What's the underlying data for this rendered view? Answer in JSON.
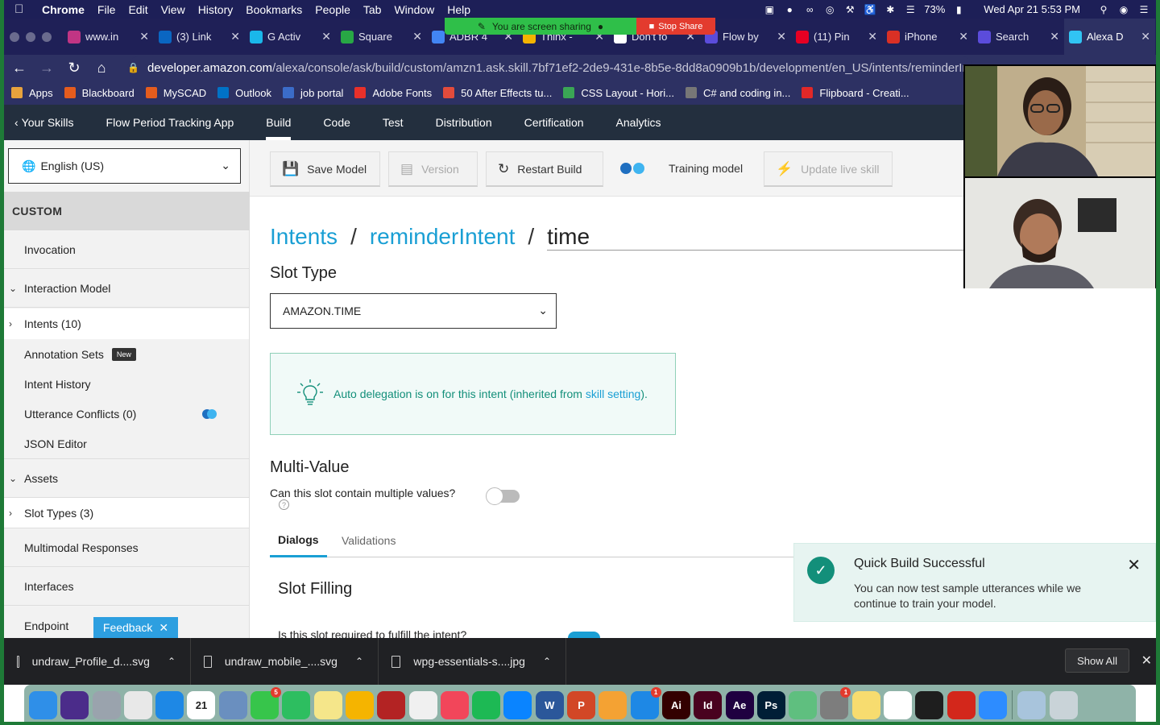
{
  "menubar": {
    "app": "Chrome",
    "menus": [
      "File",
      "Edit",
      "View",
      "History",
      "Bookmarks",
      "People",
      "Tab",
      "Window",
      "Help"
    ],
    "battery": "73%",
    "datetime": "Wed Apr 21  5:53 PM"
  },
  "screenshare": {
    "status": "You are screen sharing",
    "stop_label": "Stop Share"
  },
  "tabs": [
    {
      "title": "www.in",
      "icon": "instagram-icon",
      "color": "#c13584"
    },
    {
      "title": "(3) Link",
      "icon": "linkedin-icon",
      "color": "#0a66c2"
    },
    {
      "title": "G Activ",
      "icon": "vimeo-icon",
      "color": "#1ab7ea"
    },
    {
      "title": "Square",
      "icon": "square-icon",
      "color": "#28a745"
    },
    {
      "title": "ADBR 4",
      "icon": "docs-icon",
      "color": "#4285f4"
    },
    {
      "title": "Thinx -",
      "icon": "folder-icon",
      "color": "#f4b400"
    },
    {
      "title": "Don't fo",
      "icon": "quote-icon",
      "color": "#ffffff"
    },
    {
      "title": "Flow by",
      "icon": "canva-icon",
      "color": "#5b4cdb"
    },
    {
      "title": "(11) Pin",
      "icon": "pinterest-icon",
      "color": "#e60023"
    },
    {
      "title": "iPhone",
      "icon": "ps-icon",
      "color": "#d93025"
    },
    {
      "title": "Search",
      "icon": "search-tab-icon",
      "color": "#5b4cdb"
    },
    {
      "title": "Alexa D",
      "icon": "alexa-icon",
      "color": "#31c4f3"
    }
  ],
  "address": {
    "domain": "developer.amazon.com",
    "path": "/alexa/console/ask/build/custom/amzn1.ask.skill.7bf71ef2-2de9-431e-8b5e-8dd8a0909b1b/development/en_US/intents/reminderIn"
  },
  "bookmarks": [
    {
      "label": "Apps",
      "color": "#e8a33d"
    },
    {
      "label": "Blackboard",
      "color": "#e55c1e"
    },
    {
      "label": "MySCAD",
      "color": "#e55c1e"
    },
    {
      "label": "Outlook",
      "color": "#0072c6"
    },
    {
      "label": "job portal",
      "color": "#3b6cc9"
    },
    {
      "label": "Adobe Fonts",
      "color": "#e8302a"
    },
    {
      "label": "50 After Effects tu...",
      "color": "#e34b3c"
    },
    {
      "label": "CSS Layout - Hori...",
      "color": "#3aa655"
    },
    {
      "label": "C# and coding in...",
      "color": "#777777"
    },
    {
      "label": "Flipboard - Creati...",
      "color": "#e12828"
    }
  ],
  "alexanav": {
    "back": "Your Skills",
    "items": [
      "Flow Period Tracking App",
      "Build",
      "Code",
      "Test",
      "Distribution",
      "Certification",
      "Analytics"
    ]
  },
  "sidebar": {
    "language": "English (US)",
    "section": "CUSTOM",
    "invocation": "Invocation",
    "interaction_model": "Interaction Model",
    "intents": "Intents (10)",
    "annotation_sets": "Annotation Sets",
    "new_badge": "New",
    "intent_history": "Intent History",
    "utterance_conflicts": "Utterance Conflicts (0)",
    "json_editor": "JSON Editor",
    "assets": "Assets",
    "slot_types": "Slot Types (3)",
    "multimodal": "Multimodal Responses",
    "interfaces": "Interfaces",
    "endpoint": "Endpoint",
    "feedback": "Feedback"
  },
  "toolbar": {
    "save": "Save Model",
    "version": "Version",
    "restart": "Restart Build",
    "training": "Training model",
    "update": "Update live skill"
  },
  "breadcrumb": {
    "intents": "Intents",
    "intent": "reminderIntent",
    "slot": "time"
  },
  "slot": {
    "type_heading": "Slot Type",
    "type_value": "AMAZON.TIME",
    "info_text": "Auto delegation is on for this intent (inherited from ",
    "info_link": "skill setting",
    "info_end": ").",
    "multi_heading": "Multi-Value",
    "multi_question": "Can this slot contain multiple values?",
    "multi_enabled": false,
    "help": "?",
    "tabs": [
      "Dialogs",
      "Validations"
    ],
    "filling_heading": "Slot Filling",
    "required_question": "Is this slot required to fulfill the intent?"
  },
  "toast": {
    "title": "Quick Build Successful",
    "body": "You can now test sample utterances while we continue to train your model."
  },
  "downloads": {
    "files": [
      "undraw_Profile_d....svg",
      "undraw_mobile_....svg",
      "wpg-essentials-s....jpg"
    ],
    "show_all": "Show All"
  },
  "dock": [
    {
      "name": "finder-icon",
      "color": "#2f8fe8"
    },
    {
      "name": "siri-icon",
      "color": "#4b2c8a"
    },
    {
      "name": "launchpad-icon",
      "color": "#9aa3ad"
    },
    {
      "name": "chrome-icon",
      "color": "#e8e8e8"
    },
    {
      "name": "safari-icon",
      "color": "#1e88e5"
    },
    {
      "name": "calendar-icon",
      "color": "#ffffff",
      "label": "21"
    },
    {
      "name": "preview-icon",
      "color": "#6a8fbf"
    },
    {
      "name": "messages-icon",
      "color": "#37c54b",
      "badge": "5"
    },
    {
      "name": "evernote-icon",
      "color": "#2dbe60"
    },
    {
      "name": "notes-icon",
      "color": "#f5e68a"
    },
    {
      "name": "stickies-icon",
      "color": "#f5b400"
    },
    {
      "name": "photobooth-icon",
      "color": "#b32323"
    },
    {
      "name": "photos-icon",
      "color": "#f0f0f0"
    },
    {
      "name": "music-icon",
      "color": "#f2465a"
    },
    {
      "name": "spotify-icon",
      "color": "#1db954"
    },
    {
      "name": "messenger-icon",
      "color": "#0a84ff"
    },
    {
      "name": "word-icon",
      "color": "#2b579a",
      "label": "W"
    },
    {
      "name": "powerpoint-icon",
      "color": "#d24726",
      "label": "P"
    },
    {
      "name": "pages-icon",
      "color": "#f4a233"
    },
    {
      "name": "appstore-icon",
      "color": "#1e88e5",
      "badge": "1"
    },
    {
      "name": "illustrator-icon",
      "color": "#330000",
      "label": "Ai"
    },
    {
      "name": "indesign-icon",
      "color": "#49021f",
      "label": "Id"
    },
    {
      "name": "aftereffects-icon",
      "color": "#1f0040",
      "label": "Ae"
    },
    {
      "name": "photoshop-icon",
      "color": "#001e36",
      "label": "Ps"
    },
    {
      "name": "atom-icon",
      "color": "#5fbf7f"
    },
    {
      "name": "systemprefs-icon",
      "color": "#7d7d7d",
      "badge": "1"
    },
    {
      "name": "stickies2-icon",
      "color": "#f7dc6f"
    },
    {
      "name": "slack-icon",
      "color": "#ffffff"
    },
    {
      "name": "figma-icon",
      "color": "#1e1e1e"
    },
    {
      "name": "acrobat-icon",
      "color": "#d3271b"
    },
    {
      "name": "zoom-icon",
      "color": "#2d8cff"
    },
    {
      "name": "finder-window-icon",
      "color": "#a8c4dc"
    },
    {
      "name": "trash-icon",
      "color": "#c9d3d8"
    }
  ],
  "colors": {
    "accent": "#1a9fd4",
    "success": "#138f7a",
    "nav": "#232f3e"
  }
}
